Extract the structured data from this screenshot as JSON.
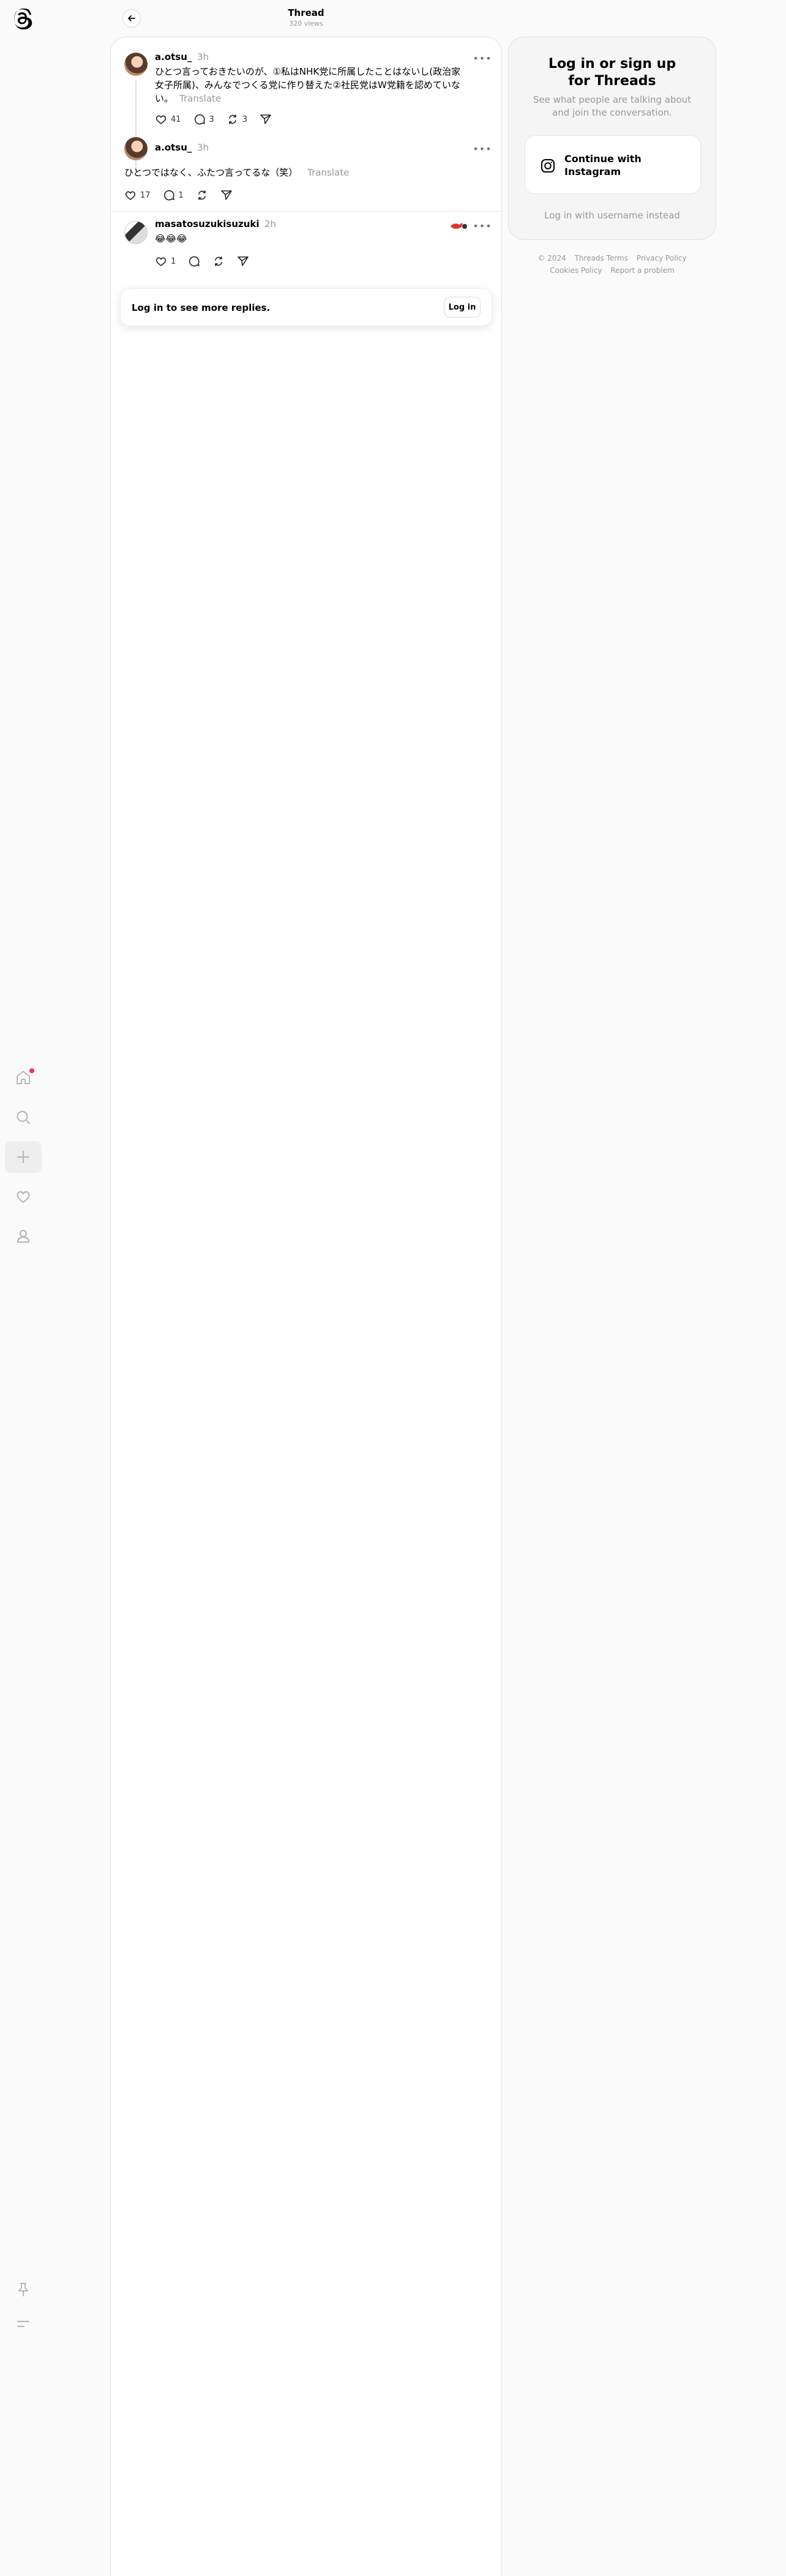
{
  "header": {
    "title": "Thread",
    "subtitle": "320 views"
  },
  "nav": [
    {
      "name": "home-icon",
      "has_dot": true
    },
    {
      "name": "search-icon"
    },
    {
      "name": "create-icon"
    },
    {
      "name": "heart-icon"
    },
    {
      "name": "profile-icon"
    }
  ],
  "bottom_nav": [
    "pin-icon",
    "menu-icon"
  ],
  "posts": [
    {
      "username": "a.otsu_",
      "time": "3h",
      "text_line1": "ひとつ言っておきたいのが、①私はNHK党に所属したことはないし(政治家",
      "text_line2": "女子所属)、みんなでつくる党に作り替えた②社民党はW党籍を認めていな",
      "text_line3": "い。",
      "translate": "Translate",
      "likes": "41",
      "replies": "3",
      "reposts": "3"
    },
    {
      "username": "a.otsu_",
      "time": "3h",
      "text": "ひとつではなく、ふたつ言ってるな（笑）",
      "translate": "Translate",
      "likes": "17",
      "replies": "1"
    },
    {
      "username": "masatosuzukisuzuki",
      "time": "2h",
      "text": "😂😂😂",
      "likes": "1"
    }
  ],
  "login_card": {
    "message": "Log in to see more replies.",
    "button": "Log in"
  },
  "side": {
    "title_line1": "Log in or sign up",
    "title_line2": "for Threads",
    "subtitle_line1": "See what people are talking about",
    "subtitle_line2": "and join the conversation.",
    "instagram_line1": "Continue with",
    "instagram_line2": "Instagram",
    "alt_login": "Log in with username instead"
  },
  "footer": {
    "copyright": "© 2024",
    "terms": "Threads Terms",
    "privacy": "Privacy Policy",
    "cookies": "Cookies Policy",
    "report": "Report a problem"
  },
  "colors": {
    "notification_dot": "#ff2d55",
    "secondary_text": "#999999"
  }
}
